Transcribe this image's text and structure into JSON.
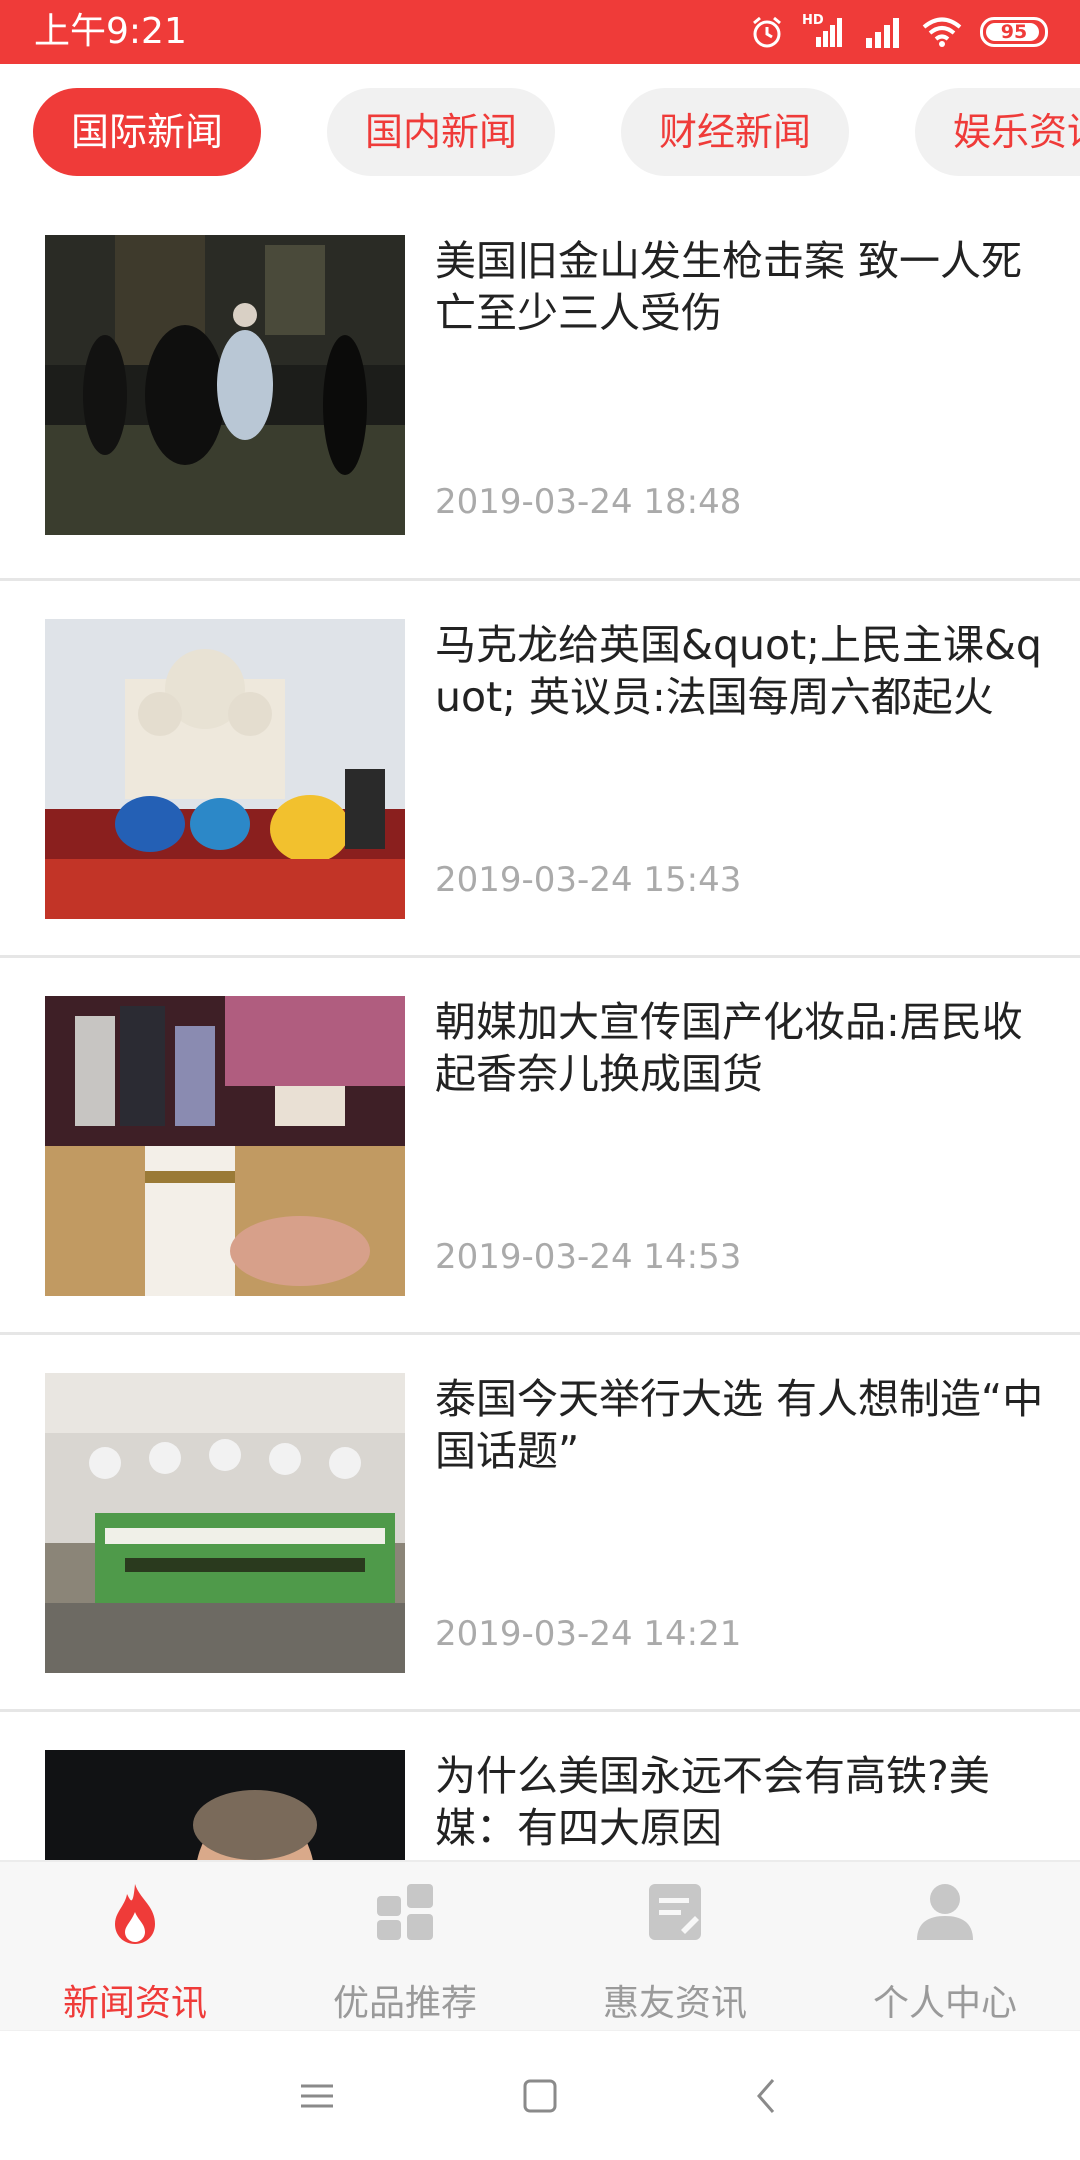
{
  "status_bar": {
    "time": "上午9:21",
    "battery": "95",
    "network_label": "HD",
    "icons": [
      "alarm-icon",
      "hd-signal-icon",
      "signal-icon",
      "wifi-icon",
      "battery-icon"
    ],
    "battery_level": 0.95
  },
  "tabs": [
    {
      "label": "国际新闻",
      "active": true
    },
    {
      "label": "国内新闻",
      "active": false
    },
    {
      "label": "财经新闻",
      "active": false
    },
    {
      "label": "娱乐资讯",
      "active": false
    }
  ],
  "news": [
    {
      "title": "美国旧金山发生枪击案 致一人死亡至少三人受伤",
      "time": "2019-03-24 18:48"
    },
    {
      "title": "马克龙给英国&quot;上民主课&quot; 英议员:法国每周六都起火",
      "time": "2019-03-24 15:43"
    },
    {
      "title": "朝媒加大宣传国产化妆品:居民收起香奈儿换成国货",
      "time": "2019-03-24 14:53"
    },
    {
      "title": "泰国今天举行大选 有人想制造“中国话题”",
      "time": "2019-03-24 14:21"
    },
    {
      "title": "为什么美国永远不会有高铁?美媒：有四大原因",
      "time": ""
    }
  ],
  "bottom_nav": [
    {
      "label": "新闻资讯",
      "icon": "flame-icon",
      "active": true
    },
    {
      "label": "优品推荐",
      "icon": "grid-icon",
      "active": false
    },
    {
      "label": "惠友资讯",
      "icon": "note-icon",
      "active": false
    },
    {
      "label": "个人中心",
      "icon": "user-icon",
      "active": false
    }
  ],
  "system_nav": [
    "menu-icon",
    "home-icon",
    "back-icon"
  ],
  "colors": {
    "accent": "#ef3b39",
    "inactive": "#9a9a9a",
    "tab_bg": "#f1f1f1"
  }
}
